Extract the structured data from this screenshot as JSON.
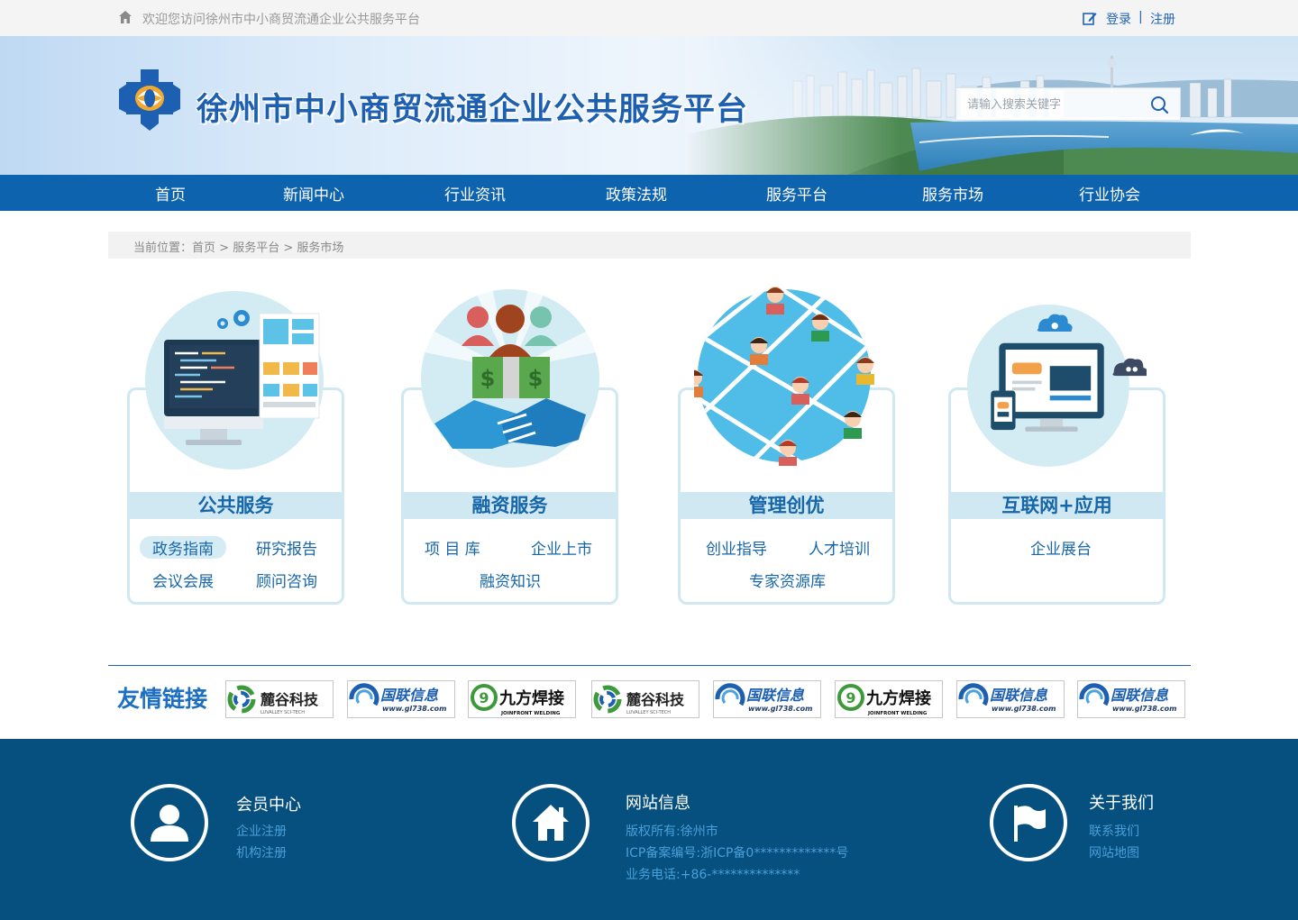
{
  "topbar": {
    "welcome": "欢迎您访问徐州市中小商贸流通企业公共服务平台",
    "login": "登录",
    "separator": "|",
    "register": "注册"
  },
  "banner": {
    "site_title": "徐州市中小商贸流通企业公共服务平台",
    "search_placeholder": "请输入搜索关键字"
  },
  "nav": {
    "items": [
      "首页",
      "新闻中心",
      "行业资讯",
      "政策法规",
      "服务平台",
      "服务市场",
      "行业协会"
    ]
  },
  "breadcrumb": {
    "prefix": "当前位置：",
    "home": "首页",
    "sep": " > ",
    "level1": "服务平台",
    "level2": "服务市场"
  },
  "cards": [
    {
      "title": "公共服务",
      "links": [
        "政务指南",
        "研究报告",
        "会议会展",
        "顾问咨询"
      ],
      "active": "政务指南"
    },
    {
      "title": "融资服务",
      "links": [
        "项 目 库",
        "企业上市",
        "融资知识"
      ]
    },
    {
      "title": "管理创优",
      "links": [
        "创业指导",
        "人才培训",
        "专家资源库"
      ]
    },
    {
      "title": "互联网+应用",
      "links": [
        "企业展台"
      ]
    }
  ],
  "friend_links": {
    "title": "友情链接",
    "logos": [
      {
        "name": "麓谷科技",
        "sub": "LUVALLEY SCI-TECH"
      },
      {
        "name": "国联信息",
        "sub": "www.gl738.com"
      },
      {
        "name": "九方焊接",
        "sub": "JOINFRONT WELDING"
      },
      {
        "name": "麓谷科技",
        "sub": "LUVALLEY SCI-TECH"
      },
      {
        "name": "国联信息",
        "sub": "www.gl738.com"
      },
      {
        "name": "九方焊接",
        "sub": "JOINFRONT WELDING"
      },
      {
        "name": "国联信息",
        "sub": "www.gl738.com"
      },
      {
        "name": "国联信息",
        "sub": "www.gl738.com"
      }
    ]
  },
  "footer": {
    "member": {
      "title": "会员中心",
      "links": [
        "企业注册",
        "机构注册"
      ]
    },
    "site_info": {
      "title": "网站信息",
      "lines": [
        "版权所有:徐州市",
        "ICP备案编号:浙ICP备0*************号",
        "业务电话:+86-**************"
      ]
    },
    "about": {
      "title": "关于我们",
      "links": [
        "联系我们",
        "网站地图"
      ]
    }
  },
  "colors": {
    "primary": "#0d63ad",
    "card_border": "#cfe8f2",
    "footer_bg": "#06507f",
    "footer_link": "#4a9fd8"
  }
}
